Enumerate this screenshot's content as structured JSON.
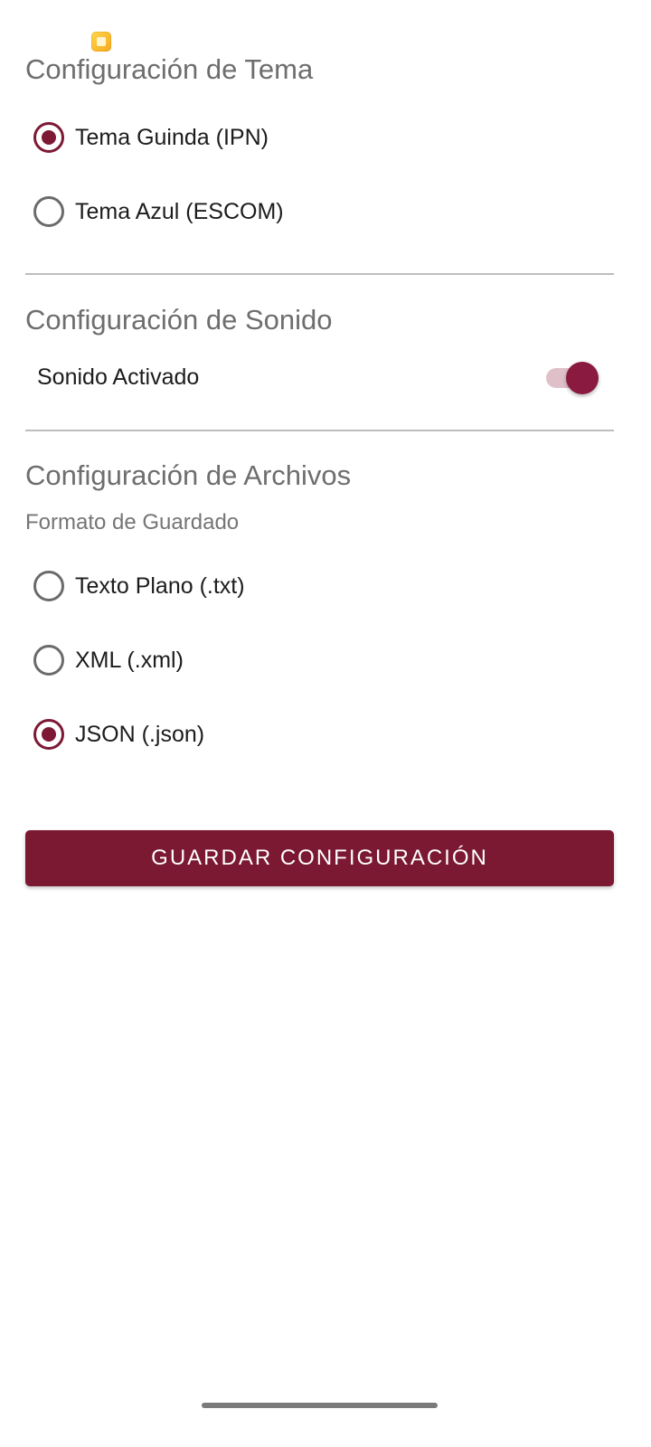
{
  "status_icon": "notification-app-icon",
  "theme": {
    "title": "Configuración de Tema",
    "options": [
      {
        "label": "Tema Guinda (IPN)",
        "checked": true
      },
      {
        "label": "Tema Azul (ESCOM)",
        "checked": false
      }
    ]
  },
  "sound": {
    "title": "Configuración de Sonido",
    "toggle_label": "Sonido Activado",
    "enabled": true
  },
  "files": {
    "title": "Configuración de Archivos",
    "subtitle": "Formato de Guardado",
    "options": [
      {
        "label": "Texto Plano (.txt)",
        "checked": false
      },
      {
        "label": "XML (.xml)",
        "checked": false
      },
      {
        "label": "JSON (.json)",
        "checked": true
      }
    ]
  },
  "save_button": {
    "label": "GUARDAR CONFIGURACIÓN"
  },
  "colors": {
    "accent": "#7b1832",
    "switch_track": "#dfc0c9",
    "divider": "#bdbdbd"
  }
}
